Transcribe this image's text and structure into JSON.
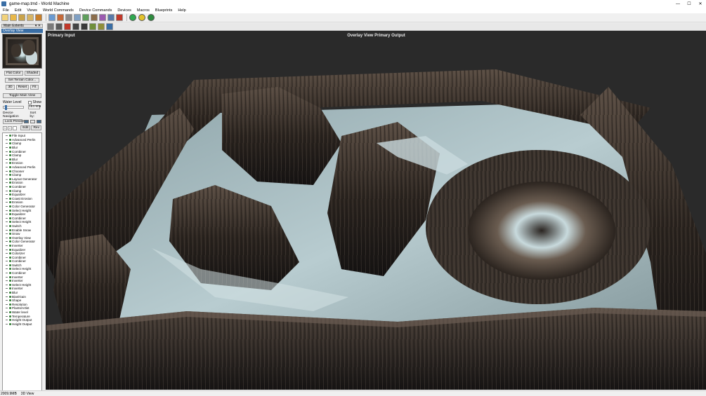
{
  "window": {
    "title": "game-map.tmd - World Machine",
    "minimize": "—",
    "maximize": "☐",
    "close": "✕"
  },
  "menu": [
    "File",
    "Edit",
    "Views",
    "World Commands",
    "Device Commands",
    "Devices",
    "Macros",
    "Blueprints",
    "Help"
  ],
  "panel": {
    "header": "Main Extents",
    "header_controls": "▾ ✕",
    "overlay_label": "Overlay View",
    "flat_color": "Flat Color",
    "shaded": "Shaded",
    "set_terrain_color": "Set Terrain Color...",
    "btn_3d": "3D",
    "btn_reset": "Reset",
    "btn_fit": "Fit",
    "toggle_main_view": "Toggle Main View",
    "water_level_label": "Water Level",
    "show_label": "Show",
    "water_level_value": "153.909",
    "device_navigation": "Device Navigation",
    "sort_by": "Sort by:",
    "lock_preview": "Lock Preview",
    "nav_prev": "<",
    "nav_next": ">",
    "edit": "Edit",
    "rev": "Rev"
  },
  "devices": [
    "File Input",
    "Advanced Perlin",
    "Clamp",
    "Blur",
    "Combiner",
    "Clamp",
    "Blur",
    "Erosion",
    "Advanced Perlin",
    "Chooser",
    "Clamp",
    "Layout Generator",
    "Erosion",
    "Combiner",
    "Clamp",
    "Equalizer",
    "Coast Erosion",
    "Erosion",
    "Color Generator",
    "Select Height",
    "Equalizer",
    "Combiner",
    "Select Height",
    "Switch",
    "Enable Snow",
    "Snow",
    "Overlay View",
    "Color Generator",
    "Inverter",
    "Equalizer",
    "Colorizer",
    "Combiner",
    "Combiner",
    "Switch",
    "Select Height",
    "Combiner",
    "Inverter",
    "Inverter",
    "Select Height",
    "Inverter",
    "Blur",
    "Bias/Gain",
    "Shape",
    "Resolution",
    "Plants/Artist",
    "Water level",
    "Temperature",
    "Height Output",
    "Height Output"
  ],
  "viewport": {
    "left_label": "Primary Input",
    "center_label": "Overlay View Primary Output"
  },
  "status": {
    "memory": "2009.9MB",
    "view": "3D View"
  },
  "colors": {
    "terrain_dark": "#2b241f",
    "terrain_mid": "#5b4e44",
    "snow": "#b8ccd0",
    "accent": "#3a6ea5"
  }
}
